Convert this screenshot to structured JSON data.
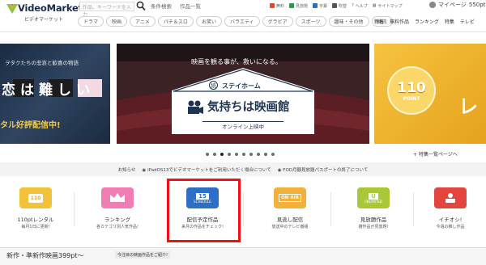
{
  "header": {
    "logo_main": "VideoMarket",
    "logo_sub": "ビデオマーケット",
    "search_placeholder": "作品、キーワードを入力",
    "links": [
      "条件検索",
      "作品一覧"
    ],
    "icon_links": [
      {
        "label": "無料",
        "color": "#e04a2a"
      },
      {
        "label": "見放題",
        "color": "#2b9b4a"
      },
      {
        "label": "字幕",
        "color": "#2b6fc2"
      },
      {
        "label": "吹替",
        "color": "#555555"
      }
    ],
    "help": "ヘルプ",
    "sitemap": "サイトマップ",
    "mypage": "マイページ",
    "points": "550pt"
  },
  "categories": [
    "ドラマ",
    "映画",
    "アニメ",
    "パチ＆スロ",
    "お笑い",
    "バラエティ",
    "グラビア",
    "スポーツ",
    "趣味・その他",
    "韓流"
  ],
  "right_nav": [
    "新着",
    "無料作品",
    "ランキング",
    "特集",
    "テレビ"
  ],
  "carousel": {
    "left_title": "ヲタクたちの悲哀と歓喜の物語",
    "left_text": "恋は難しい",
    "left_bar": "タル好評配信中!",
    "main_tagline": "映画を観る事が、救いになる。",
    "main_title_small": "ステイホーム",
    "main_title": "気持ちは映画館",
    "main_badge": "続",
    "main_footer": "オンライン上映中",
    "right_points": "110",
    "right_points_label": "POINT",
    "right_text": "レ",
    "dots_total": 10,
    "active_dot": 2
  },
  "feature_list": "特集一覧ページへ",
  "notices": [
    "お知らせ",
    "iPadOS13でビデオマーケットをご利用いただく場合について",
    "FOD月額見放題パスポートの終了について"
  ],
  "quick_links": [
    {
      "label": "110ptレンタル",
      "sub": "毎月1日に更新!",
      "icon": "110-icon",
      "icon_text": "110",
      "color": "#f2c23b"
    },
    {
      "label": "ランキング",
      "sub": "各カテゴリ別人気作品!",
      "icon": "crown-icon",
      "icon_text": "",
      "color": "#ef7fb3"
    },
    {
      "label": "配信予定作品",
      "sub": "来月の作品をチェック!",
      "icon": "calendar-icon",
      "icon_text": "15",
      "icon_subtext": "SCHEDULE",
      "color": "#2d6fc6"
    },
    {
      "label": "見逃し配信",
      "sub": "放送中のテレビ番組",
      "icon": "on-air-icon",
      "icon_text": "ON AIR",
      "color": "#f2b13a"
    },
    {
      "label": "見放題作品",
      "sub": "雑作品が見放題!",
      "icon": "unlimited-icon",
      "icon_text": "U",
      "icon_subtext": "UNLIMITED",
      "color": "#a8c83a"
    },
    {
      "label": "イチオシ!",
      "sub": "今週の推し作品",
      "icon": "recommend-icon",
      "icon_text": "",
      "color": "#e2453c"
    }
  ],
  "bottom": {
    "title": "新作・準新作映画399pt～",
    "sub": "今注目の映画作品をご紹介!"
  }
}
